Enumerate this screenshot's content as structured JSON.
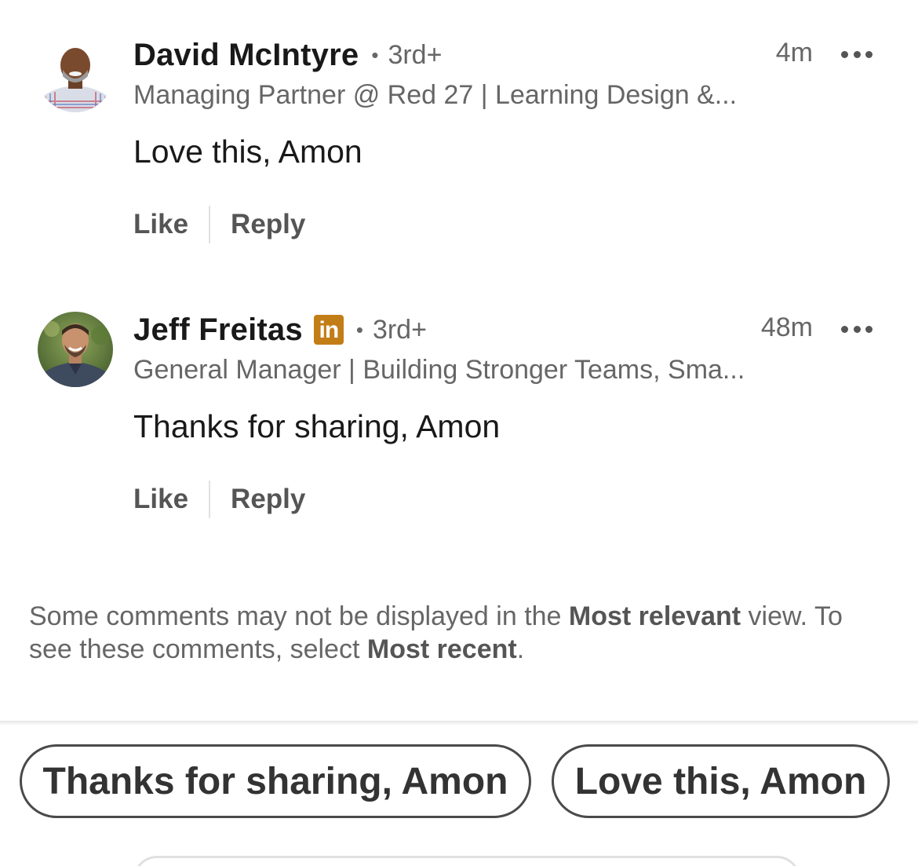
{
  "comments": [
    {
      "name": "David McIntyre",
      "separator": "•",
      "degree": "3rd+",
      "time": "4m",
      "headline": "Managing Partner @ Red 27 | Learning Design &...",
      "text": "Love this, Amon",
      "like_label": "Like",
      "reply_label": "Reply",
      "avatar_icon": "person-avatar-icon",
      "has_badge": false
    },
    {
      "name": "Jeff Freitas",
      "badge_text": "in",
      "badge_color": "#c37d16",
      "separator": "•",
      "degree": "3rd+",
      "time": "48m",
      "headline": "General Manager | Building Stronger Teams, Sma...",
      "text": "Thanks for sharing, Amon",
      "like_label": "Like",
      "reply_label": "Reply",
      "avatar_icon": "person-avatar-icon",
      "has_badge": true
    }
  ],
  "notice": {
    "part1": "Some comments may not be displayed in the ",
    "bold1": "Most relevant",
    "part2": " view. To see these comments, select ",
    "bold2": "Most recent",
    "part3": "."
  },
  "suggestions": [
    "Thanks for sharing, Amon",
    "Love this, Amon"
  ],
  "colors": {
    "text_primary": "#191919",
    "text_secondary": "#666666",
    "badge": "#c37d16"
  }
}
